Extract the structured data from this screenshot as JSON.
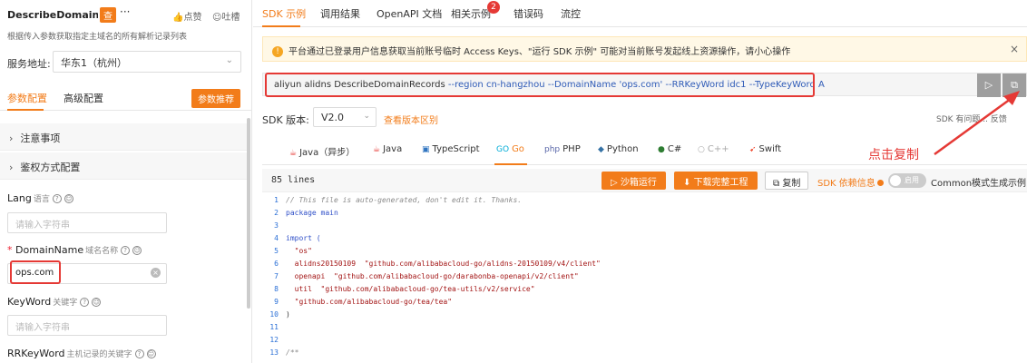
{
  "left": {
    "title": "DescribeDomainRe...",
    "tag": "查",
    "more": "···",
    "like": "点赞",
    "spit": "吐槽",
    "description": "根据传入参数获取指定主域名的所有解析记录列表",
    "server_label": "服务地址:",
    "server_value": "华东1（杭州）",
    "tab_params": "参数配置",
    "tab_advanced": "高级配置",
    "recommend_btn": "参数推荐",
    "accordions": [
      "注意事项",
      "鉴权方式配置"
    ],
    "fields": [
      {
        "name": "Lang",
        "sub": "语言",
        "placeholder": "请输入字符串",
        "value": "",
        "required": false
      },
      {
        "name": "DomainName",
        "sub": "域名名称",
        "placeholder": "",
        "value": "ops.com",
        "required": true
      },
      {
        "name": "KeyWord",
        "sub": "关键字",
        "placeholder": "请输入字符串",
        "value": "",
        "required": false
      },
      {
        "name": "RRKeyWord",
        "sub": "主机记录的关键字",
        "placeholder": "",
        "value": "",
        "required": false
      }
    ]
  },
  "right": {
    "tabs": [
      "SDK 示例",
      "调用结果",
      "OpenAPI 文档",
      "相关示例",
      "错误码",
      "流控"
    ],
    "badge": "2",
    "warning": "平台通过已登录用户信息获取当前账号临时 Access Keys、\"运行 SDK 示例\" 可能对当前账号发起线上资源操作，请小心操作",
    "command": {
      "base": "aliyun alidns DescribeDomainRecords",
      "parts": [
        "--region",
        "cn-hangzhou",
        "--DomainName",
        "'ops.com'",
        "--RRKeyWord",
        "idc1",
        "--TypeKeyWord",
        "A"
      ]
    },
    "sdk_version_label": "SDK 版本:",
    "sdk_version": "V2.0",
    "sdk_history": "查看版本区别",
    "sdk_problem": "SDK 有问题...  反馈",
    "languages": [
      "Java（异步）",
      "Java",
      "TypeScript",
      "Go",
      "PHP",
      "Python",
      "C#",
      "C++",
      "Swift"
    ],
    "active_language": "Go",
    "lines": "85 lines",
    "sandbox_btn": "沙箱运行",
    "download_btn": "下载完整工程",
    "copy_btn": "复制",
    "deps": "SDK 依赖信息",
    "toggle": "启用",
    "common": "Common模式生成示例",
    "code": [
      {
        "n": "1",
        "t": "// This file is auto-generated, don't edit it. Thanks.",
        "k": "cm"
      },
      {
        "n": "2",
        "t": "package main",
        "k": "kw"
      },
      {
        "n": "3",
        "t": "",
        "k": "tx"
      },
      {
        "n": "4",
        "t": "import (",
        "k": "kw"
      },
      {
        "n": "5",
        "t": "  \"os\"",
        "k": "str"
      },
      {
        "n": "6",
        "t": "  alidns20150109  \"github.com/alibabacloud-go/alidns-20150109/v4/client\"",
        "k": "str"
      },
      {
        "n": "7",
        "t": "  openapi  \"github.com/alibabacloud-go/darabonba-openapi/v2/client\"",
        "k": "str"
      },
      {
        "n": "8",
        "t": "  util  \"github.com/alibabacloud-go/tea-utils/v2/service\"",
        "k": "str"
      },
      {
        "n": "9",
        "t": "  \"github.com/alibabacloud-go/tea/tea\"",
        "k": "str"
      },
      {
        "n": "10",
        "t": ")",
        "k": "tx"
      },
      {
        "n": "11",
        "t": "",
        "k": "tx"
      },
      {
        "n": "12",
        "t": "",
        "k": "tx"
      },
      {
        "n": "13",
        "t": "/**",
        "k": "cm"
      }
    ],
    "annotation": "点击复制"
  },
  "colors": {
    "accent": "#f27c1a",
    "highlight": "#e53935",
    "param": "#2f5bb7"
  }
}
